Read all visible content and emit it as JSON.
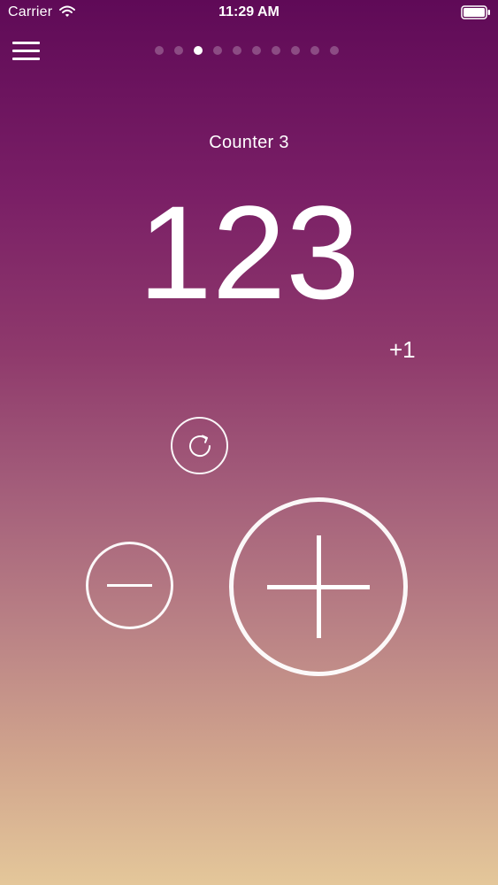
{
  "status_bar": {
    "carrier": "Carrier",
    "time": "11:29 AM",
    "wifi_icon": "wifi-icon",
    "battery_icon": "battery-icon"
  },
  "nav": {
    "menu_icon": "hamburger-menu-icon",
    "page_count": 10,
    "active_page": 3
  },
  "counter": {
    "title": "Counter 3",
    "value": "123",
    "step_label": "+1"
  },
  "controls": {
    "reset_icon": "refresh-icon",
    "decrement_icon": "minus-icon",
    "increment_icon": "plus-icon"
  },
  "colors": {
    "gradient_top": "#5f0a57",
    "gradient_bottom": "#e4c79a",
    "foreground": "#ffffff"
  }
}
